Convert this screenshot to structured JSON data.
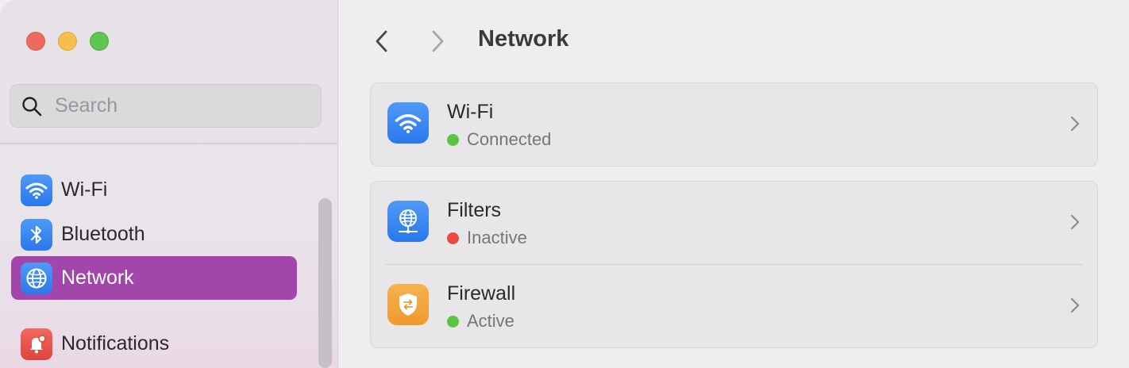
{
  "window": {
    "title": "Network",
    "traffic_lights": [
      "close",
      "minimize",
      "zoom"
    ]
  },
  "sidebar": {
    "search": {
      "placeholder": "Search",
      "value": ""
    },
    "items": [
      {
        "label": "Wi-Fi",
        "icon": "wifi-icon",
        "color": "#2f7ff0"
      },
      {
        "label": "Bluetooth",
        "icon": "bluetooth-icon",
        "color": "#2f7ff0"
      },
      {
        "label": "Network",
        "icon": "globe-icon",
        "color": "#2f7ff0",
        "selected": true
      },
      {
        "label": "Notifications",
        "icon": "bell-icon",
        "color": "#e9473e"
      }
    ],
    "selected_color": "#a246ab"
  },
  "main": {
    "title": "Network",
    "nav": {
      "back": "chevron-left-icon",
      "forward": "chevron-right-icon"
    },
    "groups": [
      {
        "rows": [
          {
            "title": "Wi-Fi",
            "status": "Connected",
            "status_color": "#5cc442",
            "icon": "wifi-icon"
          }
        ]
      },
      {
        "rows": [
          {
            "title": "Filters",
            "status": "Inactive",
            "status_color": "#e84c3d",
            "icon": "globe-filter-icon"
          },
          {
            "title": "Firewall",
            "status": "Active",
            "status_color": "#5cc442",
            "icon": "shield-icon"
          }
        ]
      }
    ]
  }
}
